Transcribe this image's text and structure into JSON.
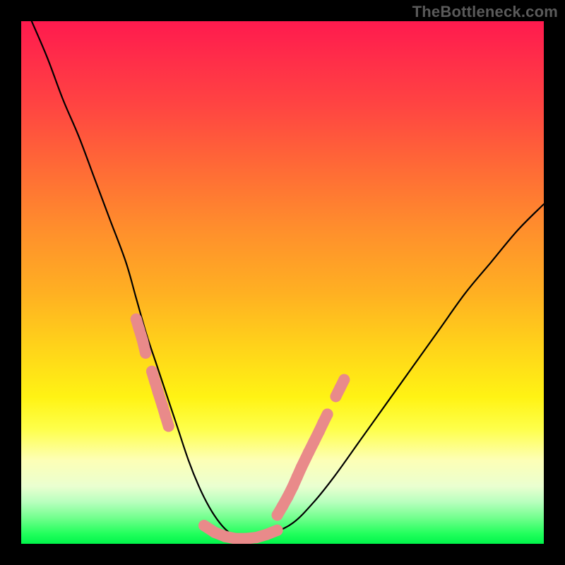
{
  "watermark": "TheBottleneck.com",
  "colors": {
    "curve_stroke": "#000000",
    "dots_fill": "#e98a8a",
    "background_black": "#000000"
  },
  "chart_data": {
    "type": "line",
    "title": "",
    "xlabel": "",
    "ylabel": "",
    "xlim": [
      0,
      100
    ],
    "ylim": [
      0,
      100
    ],
    "annotations": [
      "TheBottleneck.com"
    ],
    "series": [
      {
        "name": "bottleneck-curve",
        "x": [
          2,
          5,
          8,
          11,
          14,
          17,
          20,
          22,
          24,
          26,
          28,
          30,
          32,
          34,
          36,
          38,
          40,
          42,
          45,
          48,
          52,
          56,
          60,
          65,
          70,
          75,
          80,
          85,
          90,
          95,
          100
        ],
        "y": [
          100,
          93,
          85,
          78,
          70,
          62,
          54,
          47,
          40,
          34,
          28,
          22,
          16,
          11,
          7,
          4,
          2,
          1,
          1,
          2,
          4,
          8,
          13,
          20,
          27,
          34,
          41,
          48,
          54,
          60,
          65
        ]
      }
    ],
    "dot_clusters": [
      {
        "name": "left-descending-dots",
        "points": [
          {
            "x": 22,
            "y": 43
          },
          {
            "x": 22.6,
            "y": 41
          },
          {
            "x": 23.2,
            "y": 39
          },
          {
            "x": 23.8,
            "y": 36.5
          },
          {
            "x": 25.0,
            "y": 33
          },
          {
            "x": 25.6,
            "y": 31
          },
          {
            "x": 26.2,
            "y": 29
          },
          {
            "x": 27.0,
            "y": 26.5
          },
          {
            "x": 27.6,
            "y": 24.5
          },
          {
            "x": 28.2,
            "y": 22.5
          }
        ]
      },
      {
        "name": "valley-floor-dots",
        "points": [
          {
            "x": 35,
            "y": 3.5
          },
          {
            "x": 37,
            "y": 2.2
          },
          {
            "x": 39,
            "y": 1.4
          },
          {
            "x": 41,
            "y": 1.0
          },
          {
            "x": 43,
            "y": 1.0
          },
          {
            "x": 45,
            "y": 1.2
          },
          {
            "x": 47,
            "y": 1.8
          },
          {
            "x": 49,
            "y": 2.6
          }
        ]
      },
      {
        "name": "right-ascending-dots",
        "points": [
          {
            "x": 49,
            "y": 5.5
          },
          {
            "x": 50,
            "y": 7.2
          },
          {
            "x": 51,
            "y": 9.0
          },
          {
            "x": 52,
            "y": 11.0
          },
          {
            "x": 52.8,
            "y": 12.8
          },
          {
            "x": 53.6,
            "y": 14.6
          },
          {
            "x": 55.0,
            "y": 17.5
          },
          {
            "x": 56.0,
            "y": 19.5
          },
          {
            "x": 57.0,
            "y": 21.5
          },
          {
            "x": 57.8,
            "y": 23.2
          },
          {
            "x": 58.6,
            "y": 24.8
          },
          {
            "x": 60.2,
            "y": 28.2
          },
          {
            "x": 61.0,
            "y": 29.8
          },
          {
            "x": 61.8,
            "y": 31.4
          }
        ]
      }
    ]
  }
}
